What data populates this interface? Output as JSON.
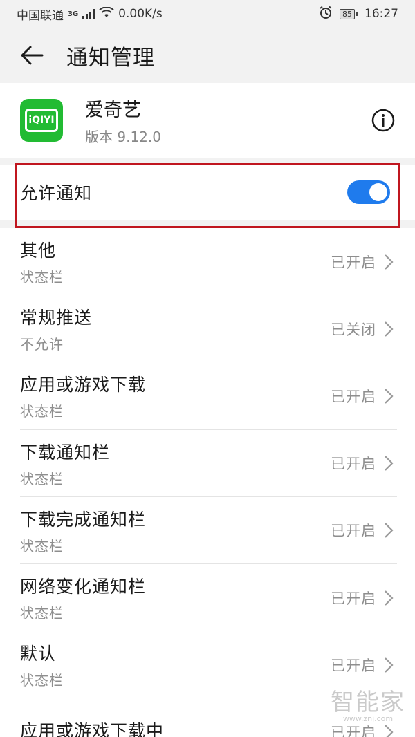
{
  "status_bar": {
    "carrier": "中国联通",
    "network": "3G",
    "speed": "0.00K/s",
    "battery": "85",
    "time": "16:27",
    "icons": [
      "signal-icon",
      "wifi-icon",
      "alarm-icon",
      "battery-icon"
    ]
  },
  "header": {
    "title": "通知管理",
    "back_icon": "back-arrow-icon"
  },
  "app": {
    "name": "爱奇艺",
    "version": "版本 9.12.0",
    "icon_text": "iQIYI",
    "icon_color": "#22bb33",
    "info_icon": "info-icon"
  },
  "allow_notifications": {
    "label": "允许通知",
    "enabled": true,
    "toggle_color": "#1f7bed",
    "highlight_color": "#c0161f"
  },
  "notification_items": [
    {
      "title": "其他",
      "subtitle": "状态栏",
      "status": "已开启"
    },
    {
      "title": "常规推送",
      "subtitle": "不允许",
      "status": "已关闭"
    },
    {
      "title": "应用或游戏下载",
      "subtitle": "状态栏",
      "status": "已开启"
    },
    {
      "title": "下载通知栏",
      "subtitle": "状态栏",
      "status": "已开启"
    },
    {
      "title": "下载完成通知栏",
      "subtitle": "状态栏",
      "status": "已开启"
    },
    {
      "title": "网络变化通知栏",
      "subtitle": "状态栏",
      "status": "已开启"
    },
    {
      "title": "默认",
      "subtitle": "状态栏",
      "status": "已开启"
    },
    {
      "title": "应用或游戏下载中",
      "subtitle": "",
      "status": "已开启"
    }
  ],
  "watermark": {
    "text": "智能家",
    "url": "www.znj.com"
  }
}
